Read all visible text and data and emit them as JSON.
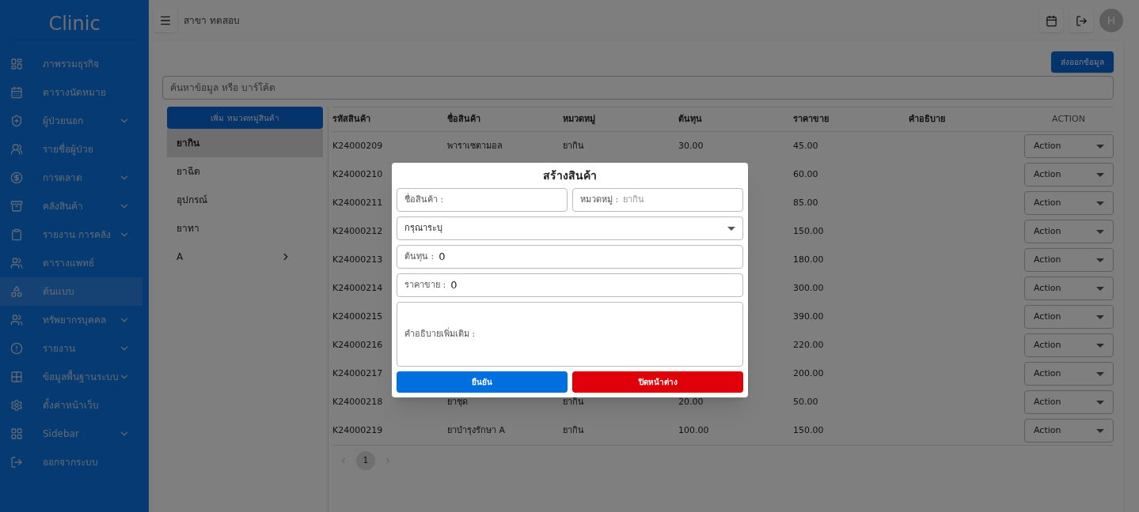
{
  "sidebar": {
    "logo": "Clinic",
    "items": [
      {
        "label": "ภาพรวมธุรกิจ",
        "expandable": false,
        "selected": false
      },
      {
        "label": "ตารางนัดหมาย",
        "expandable": false,
        "selected": false
      },
      {
        "label": "ผู้ป่วยนอก",
        "expandable": true,
        "selected": false
      },
      {
        "label": "รายชื่อผู้ป่วย",
        "expandable": false,
        "selected": false
      },
      {
        "label": "การตลาด",
        "expandable": true,
        "selected": false
      },
      {
        "label": "คลังสินค้า",
        "expandable": true,
        "selected": false
      },
      {
        "label": "รายงาน การคลัง",
        "expandable": true,
        "selected": false
      },
      {
        "label": "ตารางแพทย์",
        "expandable": false,
        "selected": false
      },
      {
        "label": "ต้นแบบ",
        "expandable": false,
        "selected": true
      },
      {
        "label": "ทรัพยากรบุคคล",
        "expandable": true,
        "selected": false
      },
      {
        "label": "รายงาน",
        "expandable": true,
        "selected": false
      },
      {
        "label": "ข้อมูลพื้นฐานระบบ",
        "expandable": true,
        "selected": false
      },
      {
        "label": "ตั้งค่าหน้าเว็บ",
        "expandable": false,
        "selected": false
      },
      {
        "label": "Sidebar",
        "expandable": true,
        "selected": false
      },
      {
        "label": "ออกจากระบบ",
        "expandable": false,
        "selected": false
      }
    ]
  },
  "header": {
    "branch": "สาขา ทดสอบ",
    "avatar": "H"
  },
  "toolbar": {
    "export_button": "ส่งออกข้อมูล",
    "search": {
      "placeholder": "ค้นหาข้อมูล หรือ บาร์โค้ด"
    }
  },
  "categories": {
    "add_button": "เพิ่ม หมวดหมู่สินค้า",
    "items": [
      {
        "label": "ยากิน",
        "selected": true,
        "expandable": false
      },
      {
        "label": "ยาฉีด",
        "selected": false,
        "expandable": false
      },
      {
        "label": "อุปกรณ์",
        "selected": false,
        "expandable": false
      },
      {
        "label": "ยาทา",
        "selected": false,
        "expandable": false
      },
      {
        "label": "A",
        "selected": false,
        "expandable": true
      }
    ]
  },
  "table": {
    "columns": [
      "รหัสสินค้า",
      "ชื่อสินค้า",
      "หมวดหมู่",
      "ต้นทุน",
      "ราคาขาย",
      "คำอธิบาย",
      "ACTION"
    ],
    "rows": [
      {
        "code": "K24000209",
        "name": "พาราเซตามอล",
        "category": "ยากิน",
        "cost": "30.00",
        "price": "45.00",
        "action": "Action"
      },
      {
        "code": "K24000210",
        "price": "60.00",
        "action": "Action"
      },
      {
        "code": "K24000211",
        "price": "85.00",
        "action": "Action"
      },
      {
        "code": "K24000212",
        "price": "150.00",
        "action": "Action"
      },
      {
        "code": "K24000213",
        "price": "180.00",
        "action": "Action"
      },
      {
        "code": "K24000214",
        "price": "300.00",
        "action": "Action"
      },
      {
        "code": "K24000215",
        "price": "390.00",
        "action": "Action"
      },
      {
        "code": "K24000216",
        "price": "220.00",
        "action": "Action"
      },
      {
        "code": "K24000217",
        "price": "200.00",
        "action": "Action"
      },
      {
        "code": "K24000218",
        "name": "ยาชุด",
        "category": "ยากิน",
        "cost": "20.00",
        "price": "50.00",
        "action": "Action"
      },
      {
        "code": "K24000219",
        "name": "ยาบำรุงรักษา A",
        "category": "ยากิน",
        "cost": "100.00",
        "price": "150.00",
        "action": "Action"
      }
    ],
    "pagination": {
      "pages": [
        {
          "label": "1",
          "selected": true
        }
      ]
    }
  },
  "dialog": {
    "title": "สร้างสินค้า",
    "name_field": {
      "label": "ชื่อสินค้า :"
    },
    "category_field": {
      "label": "หมวดหมู่ :",
      "placeholder": "ยากิน"
    },
    "select": {
      "value": "กรุณาระบุ"
    },
    "cost_field": {
      "label": "ต้นทุน :",
      "value": "0"
    },
    "price_field": {
      "label": "ราคาขาย :",
      "value": "0"
    },
    "description_field": {
      "label": "คำอธิบายเพิ่มเติม :"
    },
    "confirm_button": "ยืนยัน",
    "close_button": "ปิดหน้าต่าง"
  }
}
